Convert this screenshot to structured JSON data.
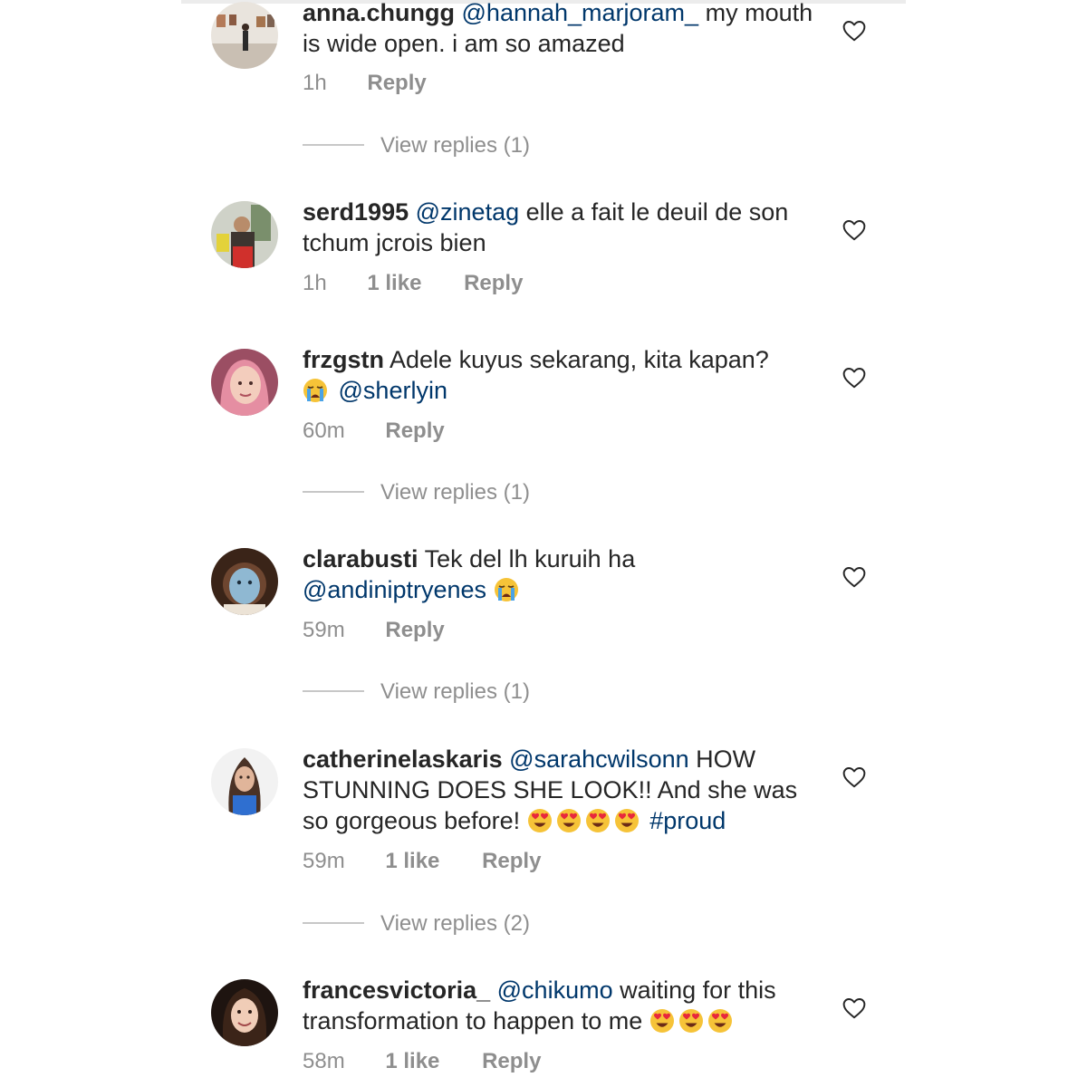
{
  "comments": [
    {
      "username": "anna.chungg",
      "mention": "@hannah_marjoram_",
      "text": " my mouth is wide open. i am so amazed",
      "time": "1h",
      "likes": "",
      "reply_label": "Reply",
      "view_replies": "View replies (1)"
    },
    {
      "username": "serd1995",
      "mention": "@zinetag",
      "text": "elle a fait le deuil de son tchum jcrois bien",
      "time": "1h",
      "likes": "1 like",
      "reply_label": "Reply",
      "view_replies": ""
    },
    {
      "username": "frzgstn",
      "text": "Adele kuyus sekarang, kita kapan?",
      "emoji": "crying-face",
      "mention": "@sherlyin",
      "time": "60m",
      "likes": "",
      "reply_label": "Reply",
      "view_replies": "View replies (1)"
    },
    {
      "username": "clarabusti",
      "text": "Tek del lh kuruih ha",
      "mention": "@andiniptryenes",
      "emoji": "crying-face",
      "time": "59m",
      "likes": "",
      "reply_label": "Reply",
      "view_replies": "View replies (1)"
    },
    {
      "username": "catherinelaskaris",
      "mention": "@sarahcwilsonn",
      "text": " HOW STUNNING DOES SHE LOOK!! And she was so gorgeous before!",
      "emoji": "heart-eyes x4",
      "hashtag": "#proud",
      "time": "59m",
      "likes": "1 like",
      "reply_label": "Reply",
      "view_replies": "View replies (2)"
    },
    {
      "username": "francesvictoria_",
      "mention": "@chikumo",
      "text": "waiting for this transformation to happen to me",
      "emoji": "heart-eyes x3",
      "time": "58m",
      "likes": "1 like",
      "reply_label": "Reply",
      "view_replies": ""
    }
  ],
  "colors": {
    "text": "#262626",
    "muted": "#8e8e8e",
    "mention": "#00376b"
  },
  "icons": {
    "like": "heart-outline-icon"
  }
}
